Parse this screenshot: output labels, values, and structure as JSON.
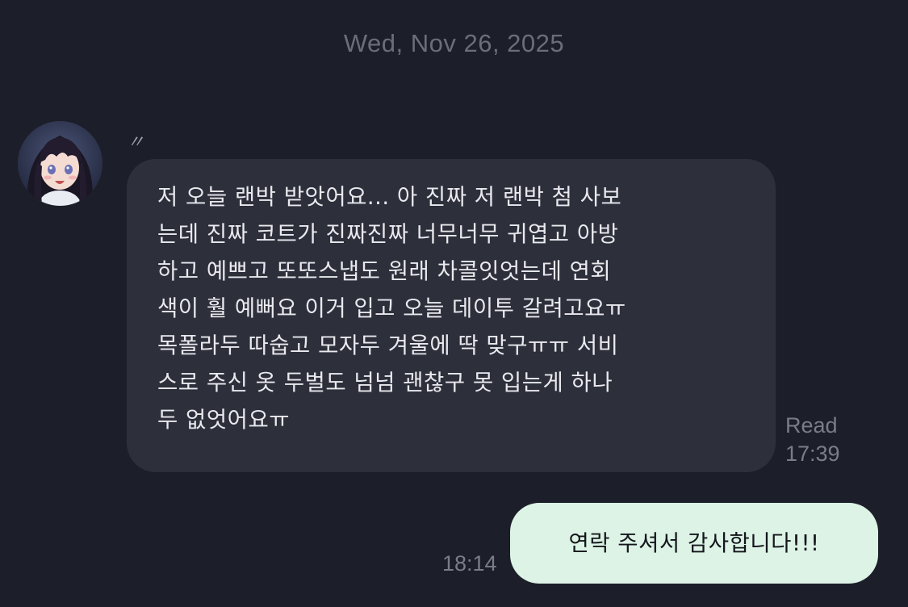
{
  "date_divider": "Wed, Nov 26, 2025",
  "incoming_message": {
    "sender_name": "〃",
    "avatar_icon": "anime-girl-avatar",
    "text": "저 오늘 랜박 받앗어요... 아 진짜 저 랜박 첨 사보\n는데 진짜 코트가 진짜진짜 너무너무 귀엽고 아방\n하고 예쁘고 또또스냅도 원래 차콜잇엇는데 연회\n색이 훨 예뻐요 이거 입고 오늘 데이투 갈려고요ㅠ\n목폴라두 따숩고 모자두 겨울에 딱 맞구ㅠㅠ 서비\n스로 주신 옷 두벌도 넘넘 괜찮구 못 입는게 하나\n두 없엇어요ㅠ",
    "read_status": "Read",
    "time": "17:39"
  },
  "outgoing_message": {
    "text": "연락 주셔서 감사합니다!!!",
    "time": "18:14"
  },
  "colors": {
    "background": "#1c1e29",
    "incoming_bubble": "#2d2f3b",
    "outgoing_bubble": "#dcf3e5",
    "meta_text": "#7a7d89"
  }
}
